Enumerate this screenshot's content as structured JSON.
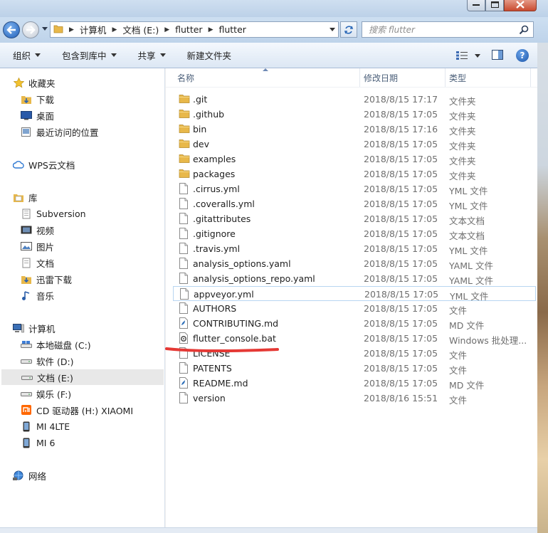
{
  "window": {
    "minimize_icon": "minimize-icon",
    "maximize_icon": "maximize-icon",
    "close_icon": "close-icon"
  },
  "address": {
    "crumbs": [
      "计算机",
      "文档 (E:)",
      "flutter",
      "flutter"
    ],
    "search_placeholder": "搜索 flutter"
  },
  "toolbar": {
    "organize": "组织",
    "include_in_library": "包含到库中",
    "share": "共享",
    "new_folder": "新建文件夹"
  },
  "nav": {
    "favorites": "收藏夹",
    "downloads": "下载",
    "desktop": "桌面",
    "recent": "最近访问的位置",
    "wps": "WPS云文档",
    "libraries": "库",
    "subversion": "Subversion",
    "videos": "视频",
    "pictures": "图片",
    "documents": "文档",
    "thunder": "迅雷下载",
    "music": "音乐",
    "computer": "计算机",
    "drive_c": "本地磁盘 (C:)",
    "drive_d": "软件 (D:)",
    "drive_e": "文档 (E:)",
    "drive_f": "娱乐 (F:)",
    "drive_h": "CD 驱动器 (H:) XIAOMI",
    "mi4lte": "MI 4LTE",
    "mi6": "MI 6",
    "network": "网络"
  },
  "columns": {
    "name": "名称",
    "date": "修改日期",
    "type": "类型"
  },
  "files": [
    {
      "name": ".git",
      "date": "2018/8/15 17:17",
      "type": "文件夹",
      "icon": "folder-icon"
    },
    {
      "name": ".github",
      "date": "2018/8/15 17:05",
      "type": "文件夹",
      "icon": "folder-icon"
    },
    {
      "name": "bin",
      "date": "2018/8/15 17:16",
      "type": "文件夹",
      "icon": "folder-icon"
    },
    {
      "name": "dev",
      "date": "2018/8/15 17:05",
      "type": "文件夹",
      "icon": "folder-icon"
    },
    {
      "name": "examples",
      "date": "2018/8/15 17:05",
      "type": "文件夹",
      "icon": "folder-icon"
    },
    {
      "name": "packages",
      "date": "2018/8/15 17:05",
      "type": "文件夹",
      "icon": "folder-icon"
    },
    {
      "name": ".cirrus.yml",
      "date": "2018/8/15 17:05",
      "type": "YML 文件",
      "icon": "file-icon"
    },
    {
      "name": ".coveralls.yml",
      "date": "2018/8/15 17:05",
      "type": "YML 文件",
      "icon": "file-icon"
    },
    {
      "name": ".gitattributes",
      "date": "2018/8/15 17:05",
      "type": "文本文档",
      "icon": "file-icon"
    },
    {
      "name": ".gitignore",
      "date": "2018/8/15 17:05",
      "type": "文本文档",
      "icon": "file-icon"
    },
    {
      "name": ".travis.yml",
      "date": "2018/8/15 17:05",
      "type": "YML 文件",
      "icon": "file-icon"
    },
    {
      "name": "analysis_options.yaml",
      "date": "2018/8/15 17:05",
      "type": "YAML 文件",
      "icon": "file-icon"
    },
    {
      "name": "analysis_options_repo.yaml",
      "date": "2018/8/15 17:05",
      "type": "YAML 文件",
      "icon": "file-icon"
    },
    {
      "name": "appveyor.yml",
      "date": "2018/8/15 17:05",
      "type": "YML 文件",
      "icon": "file-icon"
    },
    {
      "name": "AUTHORS",
      "date": "2018/8/15 17:05",
      "type": "文件",
      "icon": "file-icon"
    },
    {
      "name": "CONTRIBUTING.md",
      "date": "2018/8/15 17:05",
      "type": "MD 文件",
      "icon": "md-file-icon"
    },
    {
      "name": "flutter_console.bat",
      "date": "2018/8/15 17:05",
      "type": "Windows 批处理...",
      "icon": "bat-file-icon"
    },
    {
      "name": "LICENSE",
      "date": "2018/8/15 17:05",
      "type": "文件",
      "icon": "file-icon"
    },
    {
      "name": "PATENTS",
      "date": "2018/8/15 17:05",
      "type": "文件",
      "icon": "file-icon"
    },
    {
      "name": "README.md",
      "date": "2018/8/15 17:05",
      "type": "MD 文件",
      "icon": "md-file-icon"
    },
    {
      "name": "version",
      "date": "2018/8/16 15:51",
      "type": "文件",
      "icon": "file-icon"
    }
  ],
  "colors": {
    "annotation_red": "#e53935",
    "folder_yellow": "#e8b84a",
    "hover_border": "#b8d6f1"
  }
}
